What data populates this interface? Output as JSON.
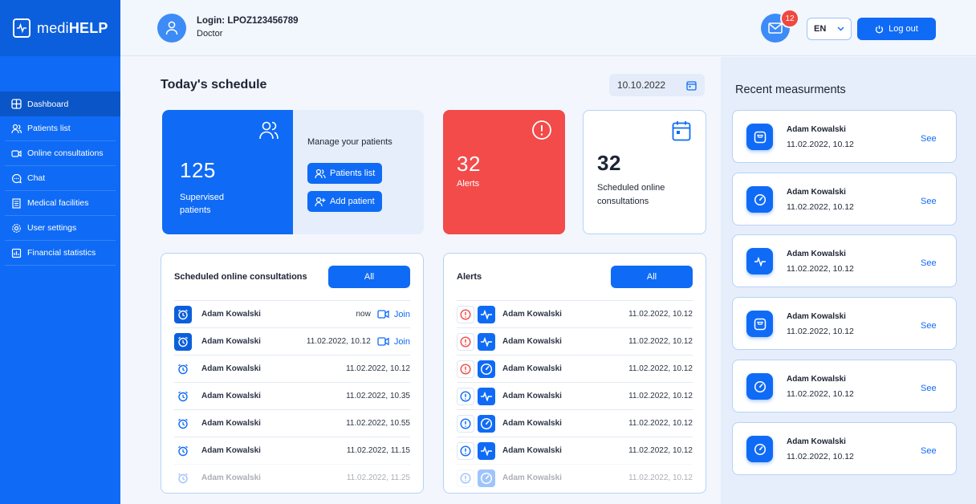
{
  "app": {
    "logo_light": "medi",
    "logo_bold": "HELP"
  },
  "colors": {
    "primary": "#0f6bf5",
    "alert": "#f34a4a",
    "badge": "#f0473e"
  },
  "sidebar": {
    "items": [
      {
        "label": "Dashboard",
        "icon": "grid-icon",
        "active": true
      },
      {
        "label": "Patients list",
        "icon": "users-icon"
      },
      {
        "label": "Online consultations",
        "icon": "video-icon"
      },
      {
        "label": "Chat",
        "icon": "chat-icon"
      },
      {
        "label": "Medical facilities",
        "icon": "building-icon"
      },
      {
        "label": "User settings",
        "icon": "gear-icon"
      },
      {
        "label": "Financial statistics",
        "icon": "chart-icon"
      }
    ]
  },
  "header": {
    "login": "Login: LPOZ123456789",
    "role": "Doctor",
    "mail_count": "12",
    "language": "EN",
    "logout_label": "Log out"
  },
  "main": {
    "title": "Today's schedule",
    "date": "10.10.2022",
    "patients_card": {
      "count": "125",
      "label": "Supervised patients",
      "manage_label": "Manage your patients",
      "list_button": "Patients list",
      "add_button": "Add patient"
    },
    "alerts_card": {
      "count": "32",
      "label": "Alerts"
    },
    "scheduled_card": {
      "count": "32",
      "label": "Scheduled online consultations"
    },
    "consultations": {
      "title": "Scheduled online consultations",
      "all_button": "All",
      "join_label": "Join",
      "rows": [
        {
          "name": "Adam Kowalski",
          "time": "now",
          "join": true,
          "highlight": true
        },
        {
          "name": "Adam Kowalski",
          "time": "11.02.2022, 10.12",
          "join": true,
          "highlight": true
        },
        {
          "name": "Adam Kowalski",
          "time": "11.02.2022, 10.12"
        },
        {
          "name": "Adam Kowalski",
          "time": "11.02.2022, 10.35"
        },
        {
          "name": "Adam Kowalski",
          "time": "11.02.2022, 10.55"
        },
        {
          "name": "Adam Kowalski",
          "time": "11.02.2022, 11.15"
        },
        {
          "name": "Adam Kowalski",
          "time": "11.02.2022, 11.25",
          "faded": true
        }
      ]
    },
    "alerts": {
      "title": "Alerts",
      "all_button": "All",
      "rows": [
        {
          "name": "Adam Kowalski",
          "time": "11.02.2022, 10.12",
          "severity": "high",
          "kind": "pulse-icon"
        },
        {
          "name": "Adam Kowalski",
          "time": "11.02.2022, 10.12",
          "severity": "high",
          "kind": "pulse-icon"
        },
        {
          "name": "Adam Kowalski",
          "time": "11.02.2022, 10.12",
          "severity": "high",
          "kind": "gauge-icon"
        },
        {
          "name": "Adam Kowalski",
          "time": "11.02.2022, 10.12",
          "severity": "info",
          "kind": "pulse-icon"
        },
        {
          "name": "Adam Kowalski",
          "time": "11.02.2022, 10.12",
          "severity": "info",
          "kind": "gauge-icon"
        },
        {
          "name": "Adam Kowalski",
          "time": "11.02.2022, 10.12",
          "severity": "info",
          "kind": "pulse-icon"
        },
        {
          "name": "Adam Kowalski",
          "time": "11.02.2022, 10.12",
          "severity": "info",
          "kind": "gauge-icon",
          "faded": true
        }
      ]
    }
  },
  "measurements": {
    "title": "Recent measurments",
    "see_label": "See",
    "items": [
      {
        "name": "Adam Kowalski",
        "date": "11.02.2022, 10.12",
        "icon": "scale-icon",
        "see_row": 0
      },
      {
        "name": "Adam Kowalski",
        "date": "11.02.2022, 10.12",
        "icon": "gauge-icon"
      },
      {
        "name": "Adam Kowalski",
        "date": "11.02.2022, 10.12",
        "icon": "pulse-icon"
      },
      {
        "name": "Adam Kowalski",
        "date": "11.02.2022, 10.12",
        "icon": "scale-icon"
      },
      {
        "name": "Adam Kowalski",
        "date": "11.02.2022, 10.12",
        "icon": "gauge-icon"
      },
      {
        "name": "Adam Kowalski",
        "date": "11.02.2022, 10.12",
        "icon": "gauge-icon"
      }
    ]
  }
}
